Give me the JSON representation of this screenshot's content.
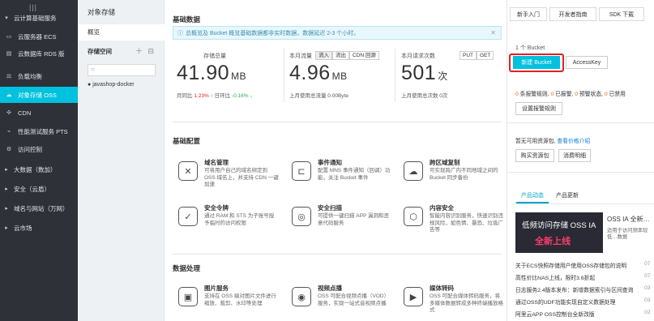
{
  "nav": {
    "items": [
      {
        "label": "云计算基础服务",
        "icon": "caret-down-icon",
        "group": true
      },
      {
        "label": "云服务器 ECS",
        "icon": "server-icon"
      },
      {
        "label": "云数据库 RDS 版",
        "icon": "database-icon"
      },
      {
        "label": "负载均衡",
        "icon": "balance-icon"
      },
      {
        "label": "对象存储 OSS",
        "icon": "oss-icon",
        "active": true
      },
      {
        "label": "CDN",
        "icon": "cdn-icon"
      },
      {
        "label": "性能测试服务 PTS",
        "icon": "pts-icon"
      },
      {
        "label": "访问控制",
        "icon": "access-icon"
      },
      {
        "label": "大数据（数加）",
        "icon": "caret-right-icon",
        "group": true
      },
      {
        "label": "安全（云盾）",
        "icon": "caret-right-icon",
        "group": true
      },
      {
        "label": "域名与网站（万网）",
        "icon": "caret-right-icon",
        "group": true
      },
      {
        "label": "云市场",
        "icon": "caret-right-icon",
        "group": true
      }
    ]
  },
  "col2": {
    "title": "对象存储",
    "overview": "概览",
    "bucket_space": "存储空间",
    "buckets": [
      "javashop-docker"
    ]
  },
  "basic": {
    "title": "基础数据",
    "notice": "总概览及 Bucket 概览基础数据都非实时数据，数据延迟 2-3 个小时。",
    "storage": {
      "label": "存储总量",
      "value": "41.90",
      "unit": "MB",
      "mom_label": "月同比",
      "mom": "1.23%",
      "dod_label": "日环比",
      "dod": "-0.16%"
    },
    "traffic": {
      "label": "本月流量",
      "tabs": [
        "流入",
        "流出",
        "CDN 回源"
      ],
      "value": "4.96",
      "unit": "MB",
      "last_month": "上月使用总流量 0.00Byte"
    },
    "requests": {
      "label": "本月请求次数",
      "tabs": [
        "PUT",
        "GET"
      ],
      "value": "501",
      "unit": "次",
      "last_month": "上月使用总次数 0次"
    }
  },
  "config": {
    "title": "基础配置",
    "features": [
      {
        "name": "域名管理",
        "desc": "可将用户自己的域名绑定到 OSS 域名上，并支持 CDN 一键加速",
        "icon": "domain-icon",
        "glyph": "✕"
      },
      {
        "name": "事件通知",
        "desc": "配置 MNS 事件通知（回调）功能，关注 Bucket 事件",
        "icon": "event-icon",
        "glyph": "⊏"
      },
      {
        "name": "跨区域复制",
        "desc": "可实现跨广内不同地域之间的 Bucket 同步备份",
        "icon": "replication-icon",
        "glyph": "☁"
      },
      {
        "name": "安全令牌",
        "desc": "通过 RAM 和 STS 为子账号授予临时的访问权限",
        "icon": "token-icon",
        "glyph": "✓"
      },
      {
        "name": "安全扫描",
        "desc": "可提供一键扫描 APP 漏洞和恶意代码服务",
        "icon": "scan-icon",
        "glyph": "◎"
      },
      {
        "name": "内容安全",
        "desc": "智能内容识别服务，快速识别违规风险，如色情、暴恐、垃圾广告等",
        "icon": "content-icon",
        "glyph": "⬡"
      }
    ]
  },
  "data": {
    "title": "数据处理",
    "features": [
      {
        "name": "图片服务",
        "desc": "支持在 OSS 端对图片文件进行缩放、裁剪、水印等处理",
        "icon": "image-icon",
        "glyph": "▣"
      },
      {
        "name": "视频点播",
        "desc": "OSS 可配合视频点播（VOD）服务，实现一站式音视频点播",
        "icon": "video-icon",
        "glyph": "◉"
      },
      {
        "name": "媒体转码",
        "desc": "OSS 可配合媒体转码服务，将多媒体数据转成多种终端播放格式",
        "icon": "media-icon",
        "glyph": "▶"
      }
    ]
  },
  "right": {
    "tabs": [
      "新手入门",
      "开发者指南",
      "SDK 下载"
    ],
    "bucket_count": "1 个 Bucket",
    "new_bucket": "新建 Bucket",
    "accesskey": "AccessKey",
    "alerts": [
      {
        "n": "0",
        "t": "条报警规则"
      },
      {
        "n": "0",
        "t": "已报警"
      },
      {
        "n": "0",
        "t": "预警状态"
      },
      {
        "n": "0",
        "t": "已禁用"
      }
    ],
    "alarm_btn": "设置报警规则",
    "no_package": "暂无可用资源包,",
    "price_link": "查看价格介绍",
    "buy_btn": "购买资源包",
    "detail_btn": "消费明细",
    "news_tabs": [
      "产品动态",
      "产品更新"
    ],
    "banner_title": "低频访问存储 OSS IA",
    "banner_sub": "全新上线",
    "banner_side_title": "OSS IA 全新…",
    "banner_side_desc": "适用于访问频率较低…数据",
    "news": [
      {
        "t": "关于ECS快照存储用户使用OSS存储包的说明",
        "d": "07"
      },
      {
        "t": "高性价比NAS上线，限时3.6折起",
        "d": "07"
      },
      {
        "t": "日志服务2.4版本发布：新增数据索引与区间查询",
        "d": "03"
      },
      {
        "t": "通过OSS的UDF功能实现自定义数据处理",
        "d": "03"
      },
      {
        "t": "阿里云APP OSS控制台全新改版",
        "d": "02"
      }
    ]
  },
  "colors": {
    "accent": "#00c1de",
    "nav_bg": "#2e3238",
    "highlight": "#e02020"
  }
}
